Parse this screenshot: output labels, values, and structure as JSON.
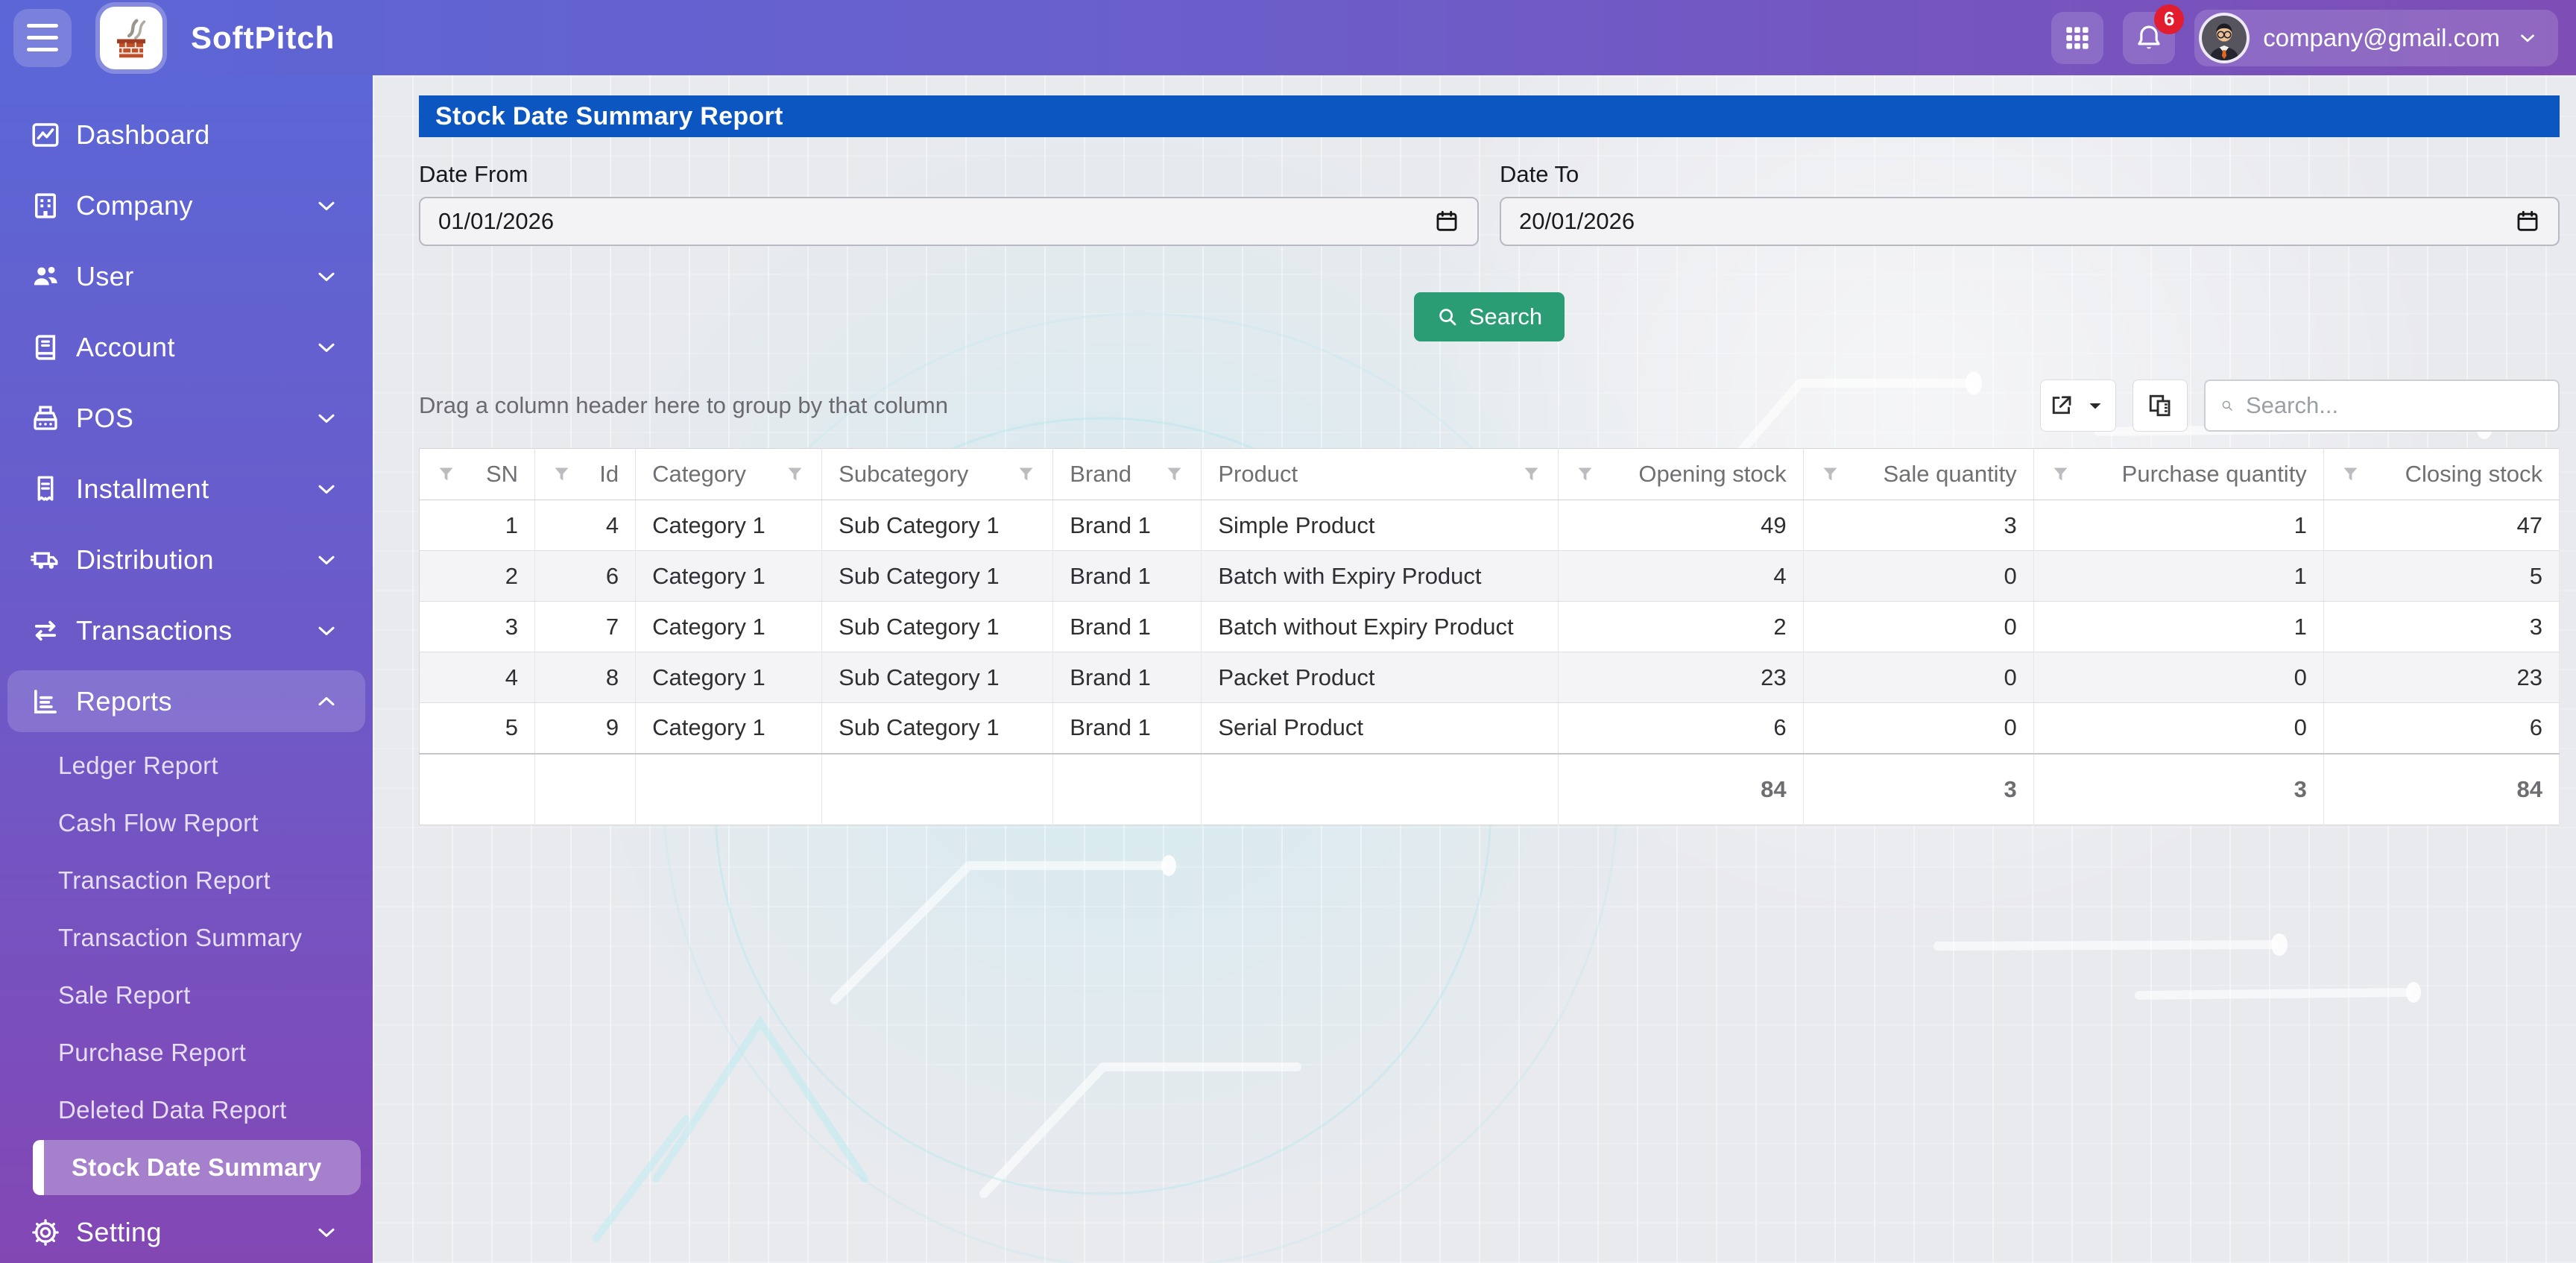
{
  "navbar": {
    "brand": "SoftPitch",
    "notification_count": "6",
    "user_email": "company@gmail.com"
  },
  "sidebar": {
    "items": [
      {
        "label": "Dashboard",
        "icon": "dashboard-icon",
        "chevron": null
      },
      {
        "label": "Company",
        "icon": "company-icon",
        "chevron": "down"
      },
      {
        "label": "User",
        "icon": "user-icon",
        "chevron": "down"
      },
      {
        "label": "Account",
        "icon": "account-icon",
        "chevron": "down"
      },
      {
        "label": "POS",
        "icon": "pos-icon",
        "chevron": "down"
      },
      {
        "label": "Installment",
        "icon": "installment-icon",
        "chevron": "down"
      },
      {
        "label": "Distribution",
        "icon": "distribution-icon",
        "chevron": "down"
      },
      {
        "label": "Transactions",
        "icon": "transactions-icon",
        "chevron": "down"
      },
      {
        "label": "Reports",
        "icon": "reports-icon",
        "chevron": "up",
        "expanded": true,
        "children": [
          "Ledger Report",
          "Cash Flow Report",
          "Transaction Report",
          "Transaction Summary",
          "Sale Report",
          "Purchase Report",
          "Deleted Data Report",
          "Stock Date Summary"
        ],
        "active_child": "Stock Date Summary"
      },
      {
        "label": "Setting",
        "icon": "setting-icon",
        "chevron": "down"
      }
    ]
  },
  "report": {
    "title": "Stock Date Summary Report",
    "date_from": {
      "label": "Date From",
      "value": "01/01/2026"
    },
    "date_to": {
      "label": "Date To",
      "value": "20/01/2026"
    },
    "search_button": "Search"
  },
  "grid": {
    "group_hint": "Drag a column header here to group by that column",
    "search_placeholder": "Search...",
    "columns": [
      {
        "label": "SN",
        "align": "right"
      },
      {
        "label": "Id",
        "align": "right"
      },
      {
        "label": "Category",
        "align": "left"
      },
      {
        "label": "Subcategory",
        "align": "left"
      },
      {
        "label": "Brand",
        "align": "left"
      },
      {
        "label": "Product",
        "align": "left"
      },
      {
        "label": "Opening stock",
        "align": "right"
      },
      {
        "label": "Sale quantity",
        "align": "right"
      },
      {
        "label": "Purchase quantity",
        "align": "right"
      },
      {
        "label": "Closing stock",
        "align": "right"
      }
    ],
    "rows": [
      [
        "1",
        "4",
        "Category 1",
        "Sub Category 1",
        "Brand 1",
        "Simple Product",
        "49",
        "3",
        "1",
        "47"
      ],
      [
        "2",
        "6",
        "Category 1",
        "Sub Category 1",
        "Brand 1",
        "Batch with Expiry Product",
        "4",
        "0",
        "1",
        "5"
      ],
      [
        "3",
        "7",
        "Category 1",
        "Sub Category 1",
        "Brand 1",
        "Batch without Expiry Product",
        "2",
        "0",
        "1",
        "3"
      ],
      [
        "4",
        "8",
        "Category 1",
        "Sub Category 1",
        "Brand 1",
        "Packet Product",
        "23",
        "0",
        "0",
        "23"
      ],
      [
        "5",
        "9",
        "Category 1",
        "Sub Category 1",
        "Brand 1",
        "Serial Product",
        "6",
        "0",
        "0",
        "6"
      ]
    ],
    "totals": [
      "",
      "",
      "",
      "",
      "",
      "",
      "84",
      "3",
      "3",
      "84"
    ]
  },
  "colors": {
    "title_bar_blue": "#0b56c0",
    "search_green": "#2a9d74",
    "badge_red": "#e11d2e",
    "nav_gradient_start": "#5c66d6",
    "nav_gradient_end": "#8347b4"
  }
}
